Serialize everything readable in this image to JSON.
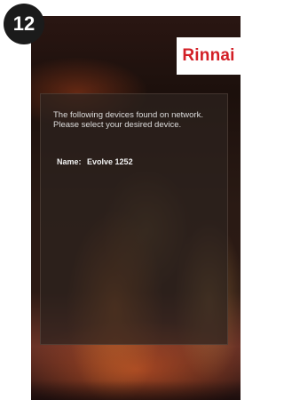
{
  "step_number": "12",
  "brand": {
    "logo_text": "Rinnai",
    "logo_color": "#d31f26"
  },
  "panel": {
    "prompt_line1": "The following devices found on network.",
    "prompt_line2": "Please select your desired device.",
    "devices": [
      {
        "name_label": "Name:",
        "name_value": "Evolve 1252"
      }
    ]
  }
}
